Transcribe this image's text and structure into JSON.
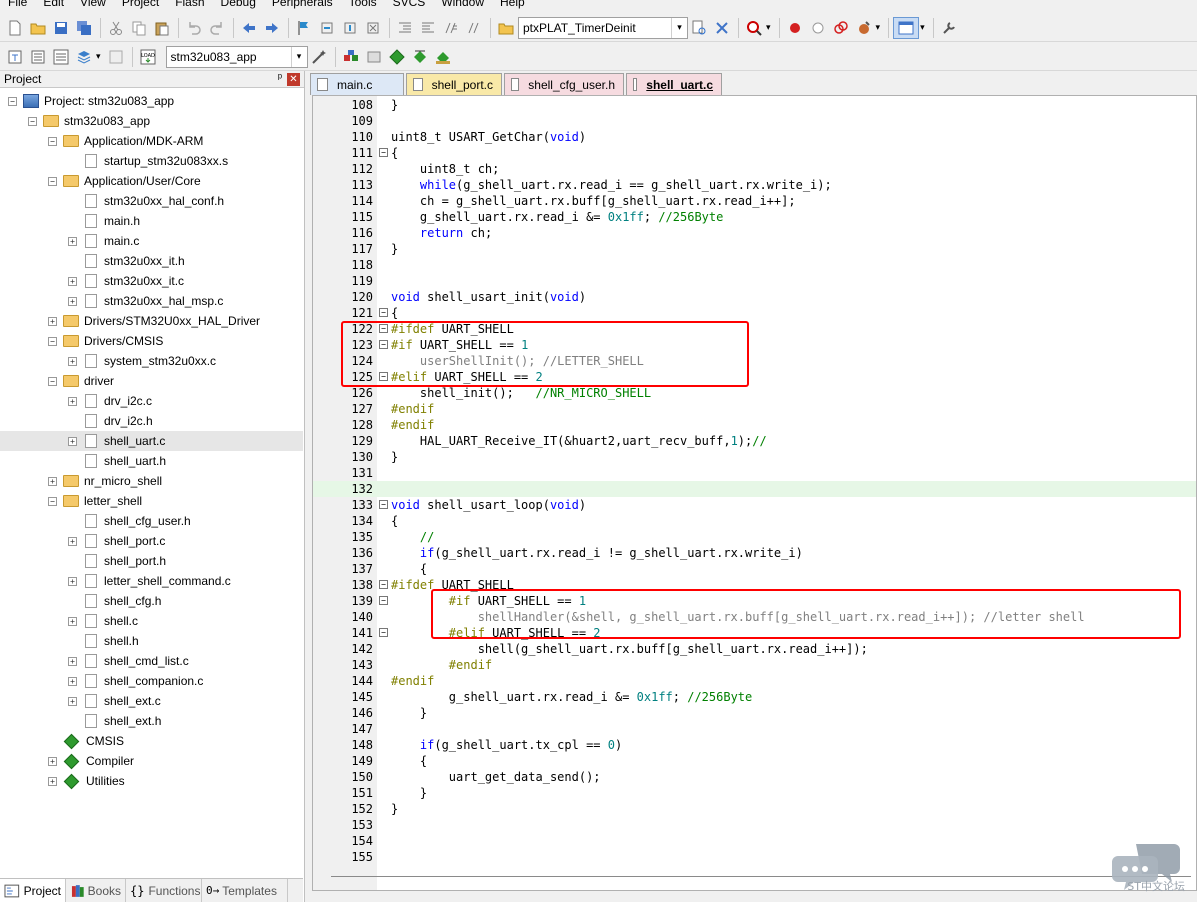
{
  "menu": [
    "File",
    "Edit",
    "View",
    "Project",
    "Flash",
    "Debug",
    "Peripherals",
    "Tools",
    "SVCS",
    "Window",
    "Help"
  ],
  "toolbar": {
    "function_combo": "ptxPLAT_TimerDeinit",
    "target_combo": "stm32u083_app",
    "load_label": "LOAD"
  },
  "project": {
    "header": "Project",
    "pin": "ᵖ",
    "close": "✕",
    "tree": [
      {
        "label": "Project: stm32u083_app"
      },
      {
        "label": "stm32u083_app"
      },
      {
        "label": "Application/MDK-ARM"
      },
      {
        "label": "startup_stm32u083xx.s"
      },
      {
        "label": "Application/User/Core"
      },
      {
        "label": "stm32u0xx_hal_conf.h"
      },
      {
        "label": "main.h"
      },
      {
        "label": "main.c"
      },
      {
        "label": "stm32u0xx_it.h"
      },
      {
        "label": "stm32u0xx_it.c"
      },
      {
        "label": "stm32u0xx_hal_msp.c"
      },
      {
        "label": "Drivers/STM32U0xx_HAL_Driver"
      },
      {
        "label": "Drivers/CMSIS"
      },
      {
        "label": "system_stm32u0xx.c"
      },
      {
        "label": "driver"
      },
      {
        "label": "drv_i2c.c"
      },
      {
        "label": "drv_i2c.h"
      },
      {
        "label": "shell_uart.c"
      },
      {
        "label": "shell_uart.h"
      },
      {
        "label": "nr_micro_shell"
      },
      {
        "label": "letter_shell"
      },
      {
        "label": "shell_cfg_user.h"
      },
      {
        "label": "shell_port.c"
      },
      {
        "label": "shell_port.h"
      },
      {
        "label": "letter_shell_command.c"
      },
      {
        "label": "shell_cfg.h"
      },
      {
        "label": "shell.c"
      },
      {
        "label": "shell.h"
      },
      {
        "label": "shell_cmd_list.c"
      },
      {
        "label": "shell_companion.c"
      },
      {
        "label": "shell_ext.c"
      },
      {
        "label": "shell_ext.h"
      },
      {
        "label": "CMSIS"
      },
      {
        "label": "Compiler"
      },
      {
        "label": "Utilities"
      }
    ],
    "bottom_tabs": [
      "Project",
      "Books",
      "Functions",
      "Templates"
    ],
    "bottom_tab_glyphs": [
      "{}",
      "0→"
    ]
  },
  "editor": {
    "tabs": [
      "main.c",
      "shell_port.c",
      "shell_cfg_user.h",
      "shell_uart.c"
    ],
    "active_tab": "shell_uart.c",
    "line_numbers": [
      "108",
      "109",
      "110",
      "111",
      "112",
      "113",
      "114",
      "115",
      "116",
      "117",
      "118",
      "119",
      "120",
      "121",
      "122",
      "123",
      "124",
      "125",
      "126",
      "127",
      "128",
      "129",
      "130",
      "131",
      "132",
      "133",
      "134",
      "135",
      "136",
      "137",
      "138",
      "139",
      "140",
      "141",
      "142",
      "143",
      "144",
      "145",
      "146",
      "147",
      "148",
      "149",
      "150",
      "151",
      "152",
      "153",
      "154",
      "155"
    ],
    "lines": [
      "}",
      "",
      "uint8_t USART_GetChar(void)",
      "{",
      "    uint8_t ch;",
      "    while(g_shell_uart.rx.read_i == g_shell_uart.rx.write_i);",
      "    ch = g_shell_uart.rx.buff[g_shell_uart.rx.read_i++];",
      "    g_shell_uart.rx.read_i &= 0x1ff; //256Byte",
      "    return ch;",
      "}",
      "",
      "",
      "void shell_usart_init(void)",
      "{",
      "#ifdef UART_SHELL",
      "#if UART_SHELL == 1",
      "    userShellInit(); //LETTER_SHELL",
      "#elif UART_SHELL == 2",
      "    shell_init();   //NR_MICRO_SHELL",
      "#endif",
      "#endif",
      "    HAL_UART_Receive_IT(&huart2,uart_recv_buff,1);//",
      "}",
      "",
      "",
      "void shell_usart_loop(void)",
      "{",
      "    //",
      "    if(g_shell_uart.rx.read_i != g_shell_uart.rx.write_i)",
      "    {",
      "#ifdef UART_SHELL",
      "        #if UART_SHELL == 1",
      "            shellHandler(&shell, g_shell_uart.rx.buff[g_shell_uart.rx.read_i++]); //letter shell",
      "        #elif UART_SHELL == 2",
      "            shell(g_shell_uart.rx.buff[g_shell_uart.rx.read_i++]);",
      "        #endif",
      "#endif",
      "        g_shell_uart.rx.read_i &= 0x1ff; //256Byte",
      "    }",
      "",
      "    if(g_shell_uart.tx_cpl == 0)",
      "    {",
      "        uart_get_data_send();",
      "    }",
      "}",
      "",
      "",
      ""
    ]
  },
  "watermark": "ST中文论坛",
  "colors": {
    "keyword": "#0000ff",
    "preprocessor": "#808000",
    "comment": "#008000",
    "number": "#008080",
    "highlight_box": "#ff0000"
  }
}
